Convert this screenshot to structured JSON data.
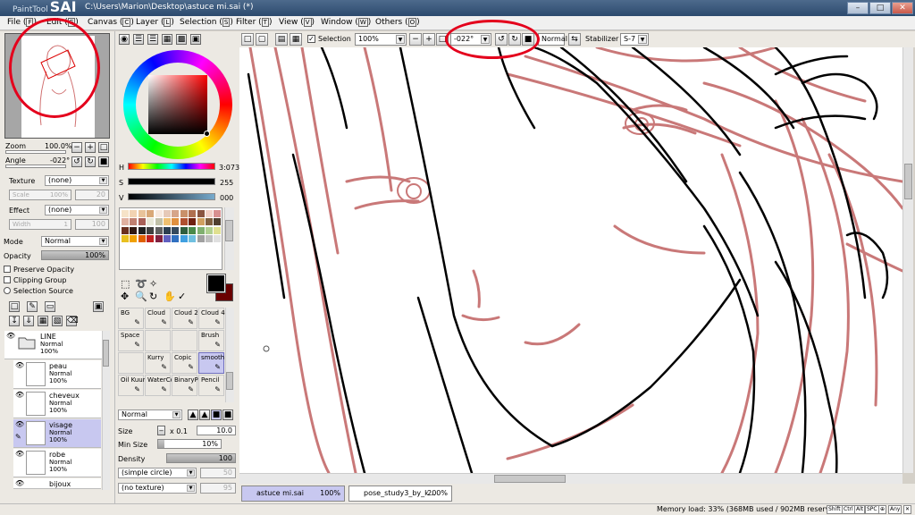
{
  "app": {
    "name_small": "PaintTool",
    "name_big": "SAI",
    "window_title": "C:\\Users\\Marion\\Desktop\\astuce mi.sai (*)",
    "min_label": "–",
    "max_label": "□",
    "close_label": "✕"
  },
  "menu": [
    {
      "label": "File",
      "key": "F"
    },
    {
      "label": "Edit",
      "key": "E"
    },
    {
      "label": "Canvas",
      "key": "C"
    },
    {
      "label": "Layer",
      "key": "L"
    },
    {
      "label": "Selection",
      "key": "S"
    },
    {
      "label": "Filter",
      "key": "T"
    },
    {
      "label": "View",
      "key": "V"
    },
    {
      "label": "Window",
      "key": "W"
    },
    {
      "label": "Others",
      "key": "O"
    }
  ],
  "toolbar": {
    "selection_label": "Selection",
    "selection_checked": true,
    "zoom_value": "100%",
    "angle_value": "-022°",
    "mode_value": "Normal",
    "stabilizer_label": "Stabilizer",
    "stabilizer_value": "S-7"
  },
  "navigator": {
    "zoom_label": "Zoom",
    "zoom_value": "100.0%",
    "zoom_level": 100,
    "angle_label": "Angle",
    "angle_value": "-022°"
  },
  "layer_props": {
    "texture_label": "Texture",
    "texture_value": "(none)",
    "scale_label": "Scale",
    "scale_value": "100%",
    "scale_num": "20",
    "effect_label": "Effect",
    "effect_value": "(none)",
    "width_label": "Width",
    "width_num": "1",
    "width_max": "100",
    "mode_label": "Mode",
    "mode_value": "Normal",
    "opacity_label": "Opacity",
    "opacity_value": "100%",
    "opacity_level": 100,
    "preserve_opacity": "Preserve Opacity",
    "clipping_group": "Clipping Group",
    "selection_source": "Selection Source"
  },
  "layers": [
    {
      "name": "LINE",
      "mode": "Normal",
      "opacity": "100%",
      "type": "folder",
      "selected": false
    },
    {
      "name": "peau",
      "mode": "Normal",
      "opacity": "100%",
      "type": "layer",
      "selected": false
    },
    {
      "name": "cheveux",
      "mode": "Normal",
      "opacity": "100%",
      "type": "layer",
      "selected": false
    },
    {
      "name": "visage",
      "mode": "Normal",
      "opacity": "100%",
      "type": "layer",
      "selected": true
    },
    {
      "name": "robe",
      "mode": "Normal",
      "opacity": "100%",
      "type": "layer",
      "selected": false
    },
    {
      "name": "bijoux",
      "mode": "Normal",
      "opacity": "100%",
      "type": "layer",
      "selected": false
    }
  ],
  "color": {
    "h_label": "H",
    "h_value": "3:073",
    "h_level": 0.01,
    "s_label": "S",
    "s_value": "255",
    "s_level": 1.0,
    "v_label": "V",
    "v_value": "000",
    "v_level": 0.0,
    "main_color": "#000000",
    "sub_color": "#6a0000"
  },
  "tools": [
    {
      "label": "BG",
      "selected": false
    },
    {
      "label": "Cloud",
      "selected": false
    },
    {
      "label": "Cloud 2",
      "selected": false
    },
    {
      "label": "Cloud 4",
      "selected": false
    },
    {
      "label": "Space",
      "selected": false
    },
    {
      "label": "",
      "selected": false
    },
    {
      "label": "",
      "selected": false
    },
    {
      "label": "Brush",
      "selected": false
    },
    {
      "label": "",
      "selected": false
    },
    {
      "label": "Kurry",
      "selected": false
    },
    {
      "label": "Copic",
      "selected": false
    },
    {
      "label": "smooth",
      "selected": true
    },
    {
      "label": "Oil Kuur",
      "selected": false
    },
    {
      "label": "WaterCc",
      "selected": false
    },
    {
      "label": "BinaryPe",
      "selected": false
    },
    {
      "label": "Pencil",
      "selected": false
    }
  ],
  "brush": {
    "mode_value": "Normal",
    "size_label": "Size",
    "size_mult": "x 0.1",
    "size_value": "10.0",
    "minsize_label": "Min Size",
    "minsize_value": "10%",
    "density_label": "Density",
    "density_value": "100",
    "shape_value": "(simple circle)",
    "shape_num": "50",
    "texture_value": "(no texture)",
    "texture_num": "95"
  },
  "doc_tabs": [
    {
      "name": "astuce mi.sai",
      "zoom": "100%",
      "active": true
    },
    {
      "name": "pose_study3_by_k...",
      "zoom": "200%",
      "active": false
    }
  ],
  "status": {
    "memory": "Memory load: 33% (368MB used / 902MB reserved)",
    "keys": [
      "Shift",
      "Ctrl",
      "Alt",
      "SPC",
      "⊕",
      "Any",
      "✕"
    ]
  },
  "colors": {
    "annotation": "#e4001c",
    "sketch_red": "#c97878",
    "line_black": "#000000",
    "selected_bg": "#c8c8f0"
  }
}
